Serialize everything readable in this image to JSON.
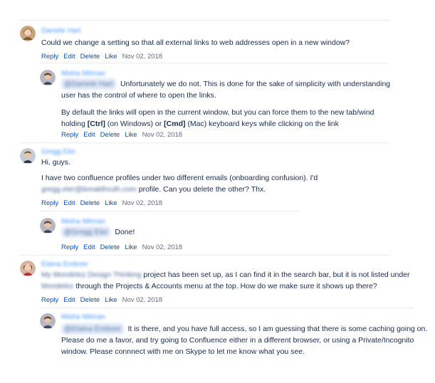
{
  "comments": [
    {
      "author": "Daniele Hart",
      "lines": [
        "Could we change a setting so that all external links to web addresses open in a new window?"
      ],
      "actions": [
        "Reply",
        "Edit",
        "Delete",
        "Like"
      ],
      "date": "Nov 02, 2018"
    },
    {
      "author": "Misha Mitman",
      "mention": "@Daniele Hart",
      "line1_text": "Unfortunately we do not. This is done for the sake of simplicity with understanding",
      "line2": "user has the control of where to open the links.",
      "para2_line1": "By default the links will open in the current window, but you can force them to the new tab/wind",
      "para2_line2_pre": "holding",
      "ctrl_key": "[Ctrl]",
      "para2_line2_mid": "(on Windows) or",
      "cmd_key": "[Cmd]",
      "para2_line2_post": "(Mac) keyboard keys while clicking on the link",
      "actions": [
        "Reply",
        "Edit",
        "Delete",
        "Like"
      ],
      "date": "Nov 02, 2018"
    },
    {
      "author": "Gregg Eler",
      "line1": "Hi, guys.",
      "line2": "I have two confluence profiles under two different emails (onboarding confusion). I'd",
      "email_blur": "gregg.eler@breakthruth.com",
      "line3_post": "profile. Can you delete the other? Thx.",
      "actions": [
        "Reply",
        "Edit",
        "Delete",
        "Like"
      ],
      "date": "Nov 02, 2018"
    },
    {
      "author": "Misha Mitman",
      "mention": "@Gregg Eler",
      "text": "Done!",
      "actions": [
        "Reply",
        "Edit",
        "Delete",
        "Like"
      ],
      "date": "Nov 02, 2018"
    },
    {
      "author": "Elaina Embree",
      "line1_blur": "My Mondelez Design Thinking",
      "line1_post": "project has been set up, as I can find it in the search bar, but it is not listed under",
      "line2_blur": "Mondelez",
      "line2_post": "through the Projects & Accounts menu at the top.  How do we make sure it shows up there?",
      "actions": [
        "Reply",
        "Edit",
        "Delete",
        "Like"
      ],
      "date": "Nov 02, 2018"
    },
    {
      "author": "Misha Mitman",
      "mention": "@Elaina Embree",
      "line1": "It is there, and you have full access, so I am guessing that there is some caching going on.",
      "line2": "Please do me a favor, and try going to Confluence either in a different browser, or using a Private/Incognito",
      "line3": "window. Please connnect with me on Skype to let me know what you see."
    }
  ]
}
